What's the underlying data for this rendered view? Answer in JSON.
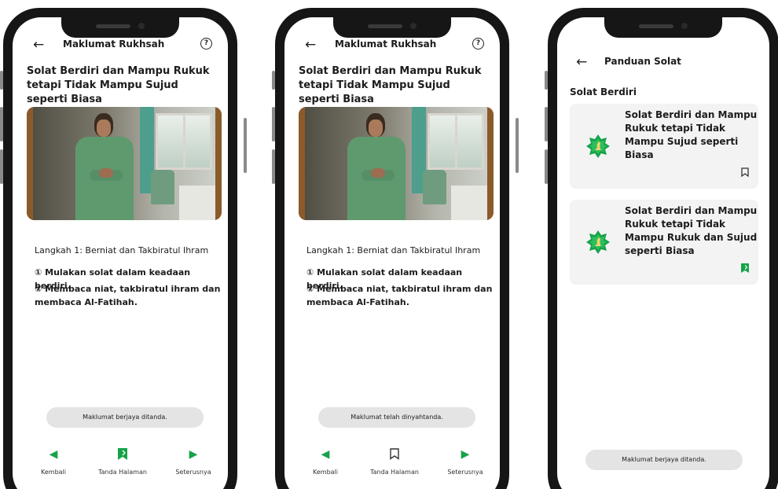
{
  "colors": {
    "accent": "#16a34a",
    "toast_bg": "#e4e4e4",
    "card_bg": "#f3f3f3"
  },
  "phone1": {
    "header": {
      "title": "Maklumat Rukhsah",
      "back_icon": "arrow-left-icon",
      "help_icon": "question-circle-icon"
    },
    "lesson_title": "Solat Berdiri dan Mampu Rukuk tetapi Tidak Mampu Sujud seperti Biasa",
    "step": {
      "title": "Langkah 1: Berniat dan Takbiratul Ihram",
      "line1": "① Mulakan solat dalam keadaan berdiri.",
      "line2": "② Membaca niat, takbiratul ihram dan membaca Al-Fatihah."
    },
    "toast": "Maklumat berjaya ditanda.",
    "nav": {
      "back_label": "Kembali",
      "mark_label": "Tanda Halaman",
      "next_label": "Seterusnya",
      "mark_state": "bookmarked"
    }
  },
  "phone2": {
    "header": {
      "title": "Maklumat Rukhsah",
      "back_icon": "arrow-left-icon",
      "help_icon": "question-circle-icon"
    },
    "lesson_title": "Solat Berdiri dan Mampu Rukuk tetapi Tidak Mampu Sujud seperti Biasa",
    "step": {
      "title": "Langkah 1: Berniat dan Takbiratul Ihram",
      "line1": "① Mulakan solat dalam keadaan berdiri.",
      "line2": "② Membaca niat, takbiratul ihram dan membaca Al-Fatihah."
    },
    "toast": "Maklumat telah dinyahtanda.",
    "nav": {
      "back_label": "Kembali",
      "mark_label": "Tanda Halaman",
      "next_label": "Seterusnya",
      "mark_state": "not-bookmarked"
    }
  },
  "phone3": {
    "header": {
      "title": "Panduan Solat",
      "back_icon": "arrow-left-icon"
    },
    "section_title": "Solat Berdiri",
    "cards": [
      {
        "title": "Solat Berdiri dan Mampu Rukuk tetapi Tidak Mampu Sujud seperti Biasa",
        "icon": "prayer-star-icon",
        "bookmark": "not-bookmarked"
      },
      {
        "title": "Solat Berdiri dan Mampu Rukuk tetapi Tidak Mampu Rukuk dan Sujud seperti Biasa",
        "icon": "prayer-star-icon",
        "bookmark": "bookmarked"
      }
    ],
    "toast": "Maklumat berjaya ditanda."
  }
}
